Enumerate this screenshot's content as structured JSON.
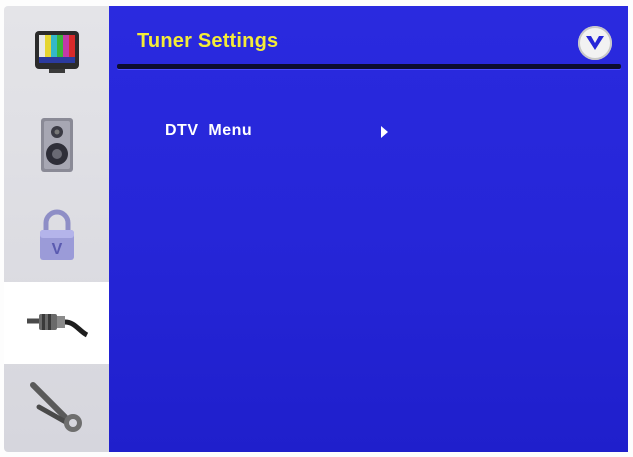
{
  "header": {
    "title": "Tuner Settings",
    "logo_icon": "vizio-v-logo-icon"
  },
  "sidebar": {
    "items": [
      {
        "name": "picture",
        "icon": "tv-color-bars-icon",
        "selected": false
      },
      {
        "name": "audio",
        "icon": "speaker-icon",
        "selected": false
      },
      {
        "name": "parental-lock",
        "icon": "padlock-icon",
        "selected": false
      },
      {
        "name": "tuner",
        "icon": "coax-cable-icon",
        "selected": true
      },
      {
        "name": "setup",
        "icon": "wrench-icon",
        "selected": false
      }
    ]
  },
  "menu": {
    "items": [
      {
        "label": "DTV  Menu",
        "arrow_icon": "right-triangle-icon"
      }
    ]
  },
  "colors": {
    "accent": "#f4ec38",
    "background": "#2626d8",
    "text": "#ffffff"
  }
}
